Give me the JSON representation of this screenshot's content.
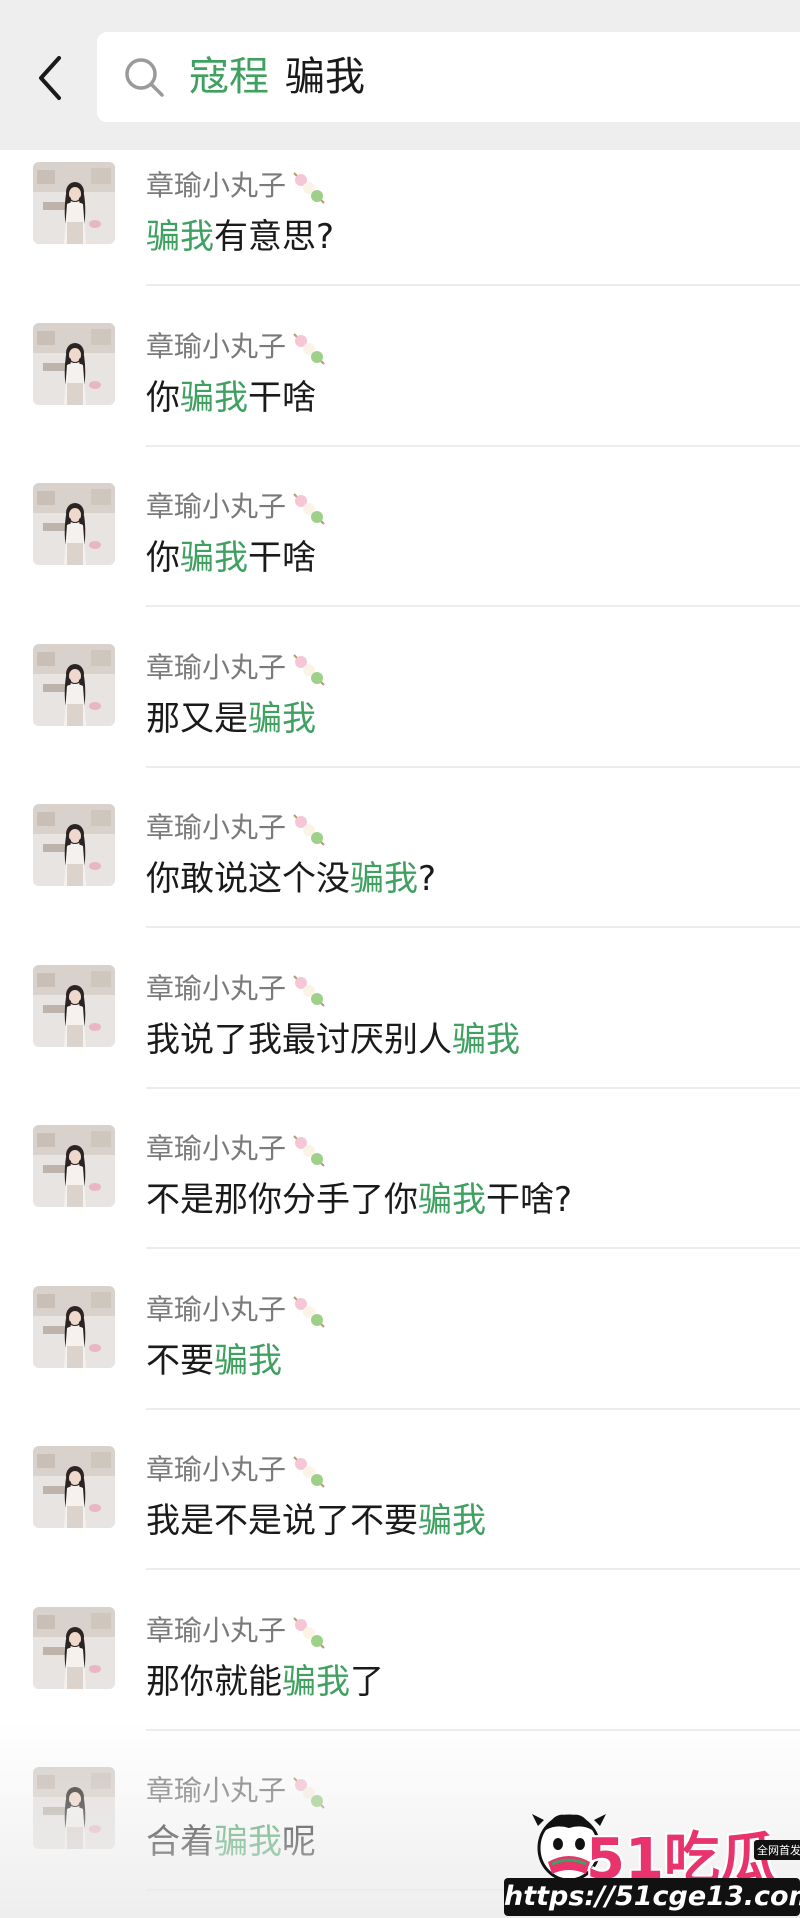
{
  "search": {
    "contact_name": "寇程",
    "term": "骗我"
  },
  "results": [
    {
      "sender": "章瑜小丸子",
      "emoji": "dango-icon",
      "parts": [
        {
          "t": "骗我",
          "h": true
        },
        {
          "t": "有意思?",
          "h": false
        }
      ]
    },
    {
      "sender": "章瑜小丸子",
      "emoji": "dango-icon",
      "parts": [
        {
          "t": "你",
          "h": false
        },
        {
          "t": "骗我",
          "h": true
        },
        {
          "t": "干啥",
          "h": false
        }
      ]
    },
    {
      "sender": "章瑜小丸子",
      "emoji": "dango-icon",
      "parts": [
        {
          "t": "你",
          "h": false
        },
        {
          "t": "骗我",
          "h": true
        },
        {
          "t": "干啥",
          "h": false
        }
      ]
    },
    {
      "sender": "章瑜小丸子",
      "emoji": "dango-icon",
      "parts": [
        {
          "t": "那又是",
          "h": false
        },
        {
          "t": "骗我",
          "h": true
        }
      ]
    },
    {
      "sender": "章瑜小丸子",
      "emoji": "dango-icon",
      "parts": [
        {
          "t": "你敢说这个没",
          "h": false
        },
        {
          "t": "骗我",
          "h": true
        },
        {
          "t": "?",
          "h": false
        }
      ]
    },
    {
      "sender": "章瑜小丸子",
      "emoji": "dango-icon",
      "parts": [
        {
          "t": "我说了我最讨厌别人",
          "h": false
        },
        {
          "t": "骗我",
          "h": true
        }
      ]
    },
    {
      "sender": "章瑜小丸子",
      "emoji": "dango-icon",
      "parts": [
        {
          "t": "不是那你分手了你",
          "h": false
        },
        {
          "t": "骗我",
          "h": true
        },
        {
          "t": "干啥?",
          "h": false
        }
      ]
    },
    {
      "sender": "章瑜小丸子",
      "emoji": "dango-icon",
      "parts": [
        {
          "t": "不要",
          "h": false
        },
        {
          "t": "骗我",
          "h": true
        }
      ]
    },
    {
      "sender": "章瑜小丸子",
      "emoji": "dango-icon",
      "parts": [
        {
          "t": "我是不是说了不要",
          "h": false
        },
        {
          "t": "骗我",
          "h": true
        }
      ]
    },
    {
      "sender": "章瑜小丸子",
      "emoji": "dango-icon",
      "parts": [
        {
          "t": "那你就能",
          "h": false
        },
        {
          "t": "骗我",
          "h": true
        },
        {
          "t": "了",
          "h": false
        }
      ]
    },
    {
      "sender": "章瑜小丸子",
      "emoji": "dango-icon",
      "parts": [
        {
          "t": "合着",
          "h": false
        },
        {
          "t": "骗我",
          "h": true
        },
        {
          "t": "呢",
          "h": false
        }
      ]
    }
  ],
  "watermark": {
    "logo": "51吃瓜",
    "tag": "全网首发",
    "url": "https://51cge13.com"
  },
  "colors": {
    "highlight": "#3fa160",
    "topbar_bg": "#eeeeee",
    "text": "#1a1a1a",
    "sender_text": "#7a7a7a"
  }
}
